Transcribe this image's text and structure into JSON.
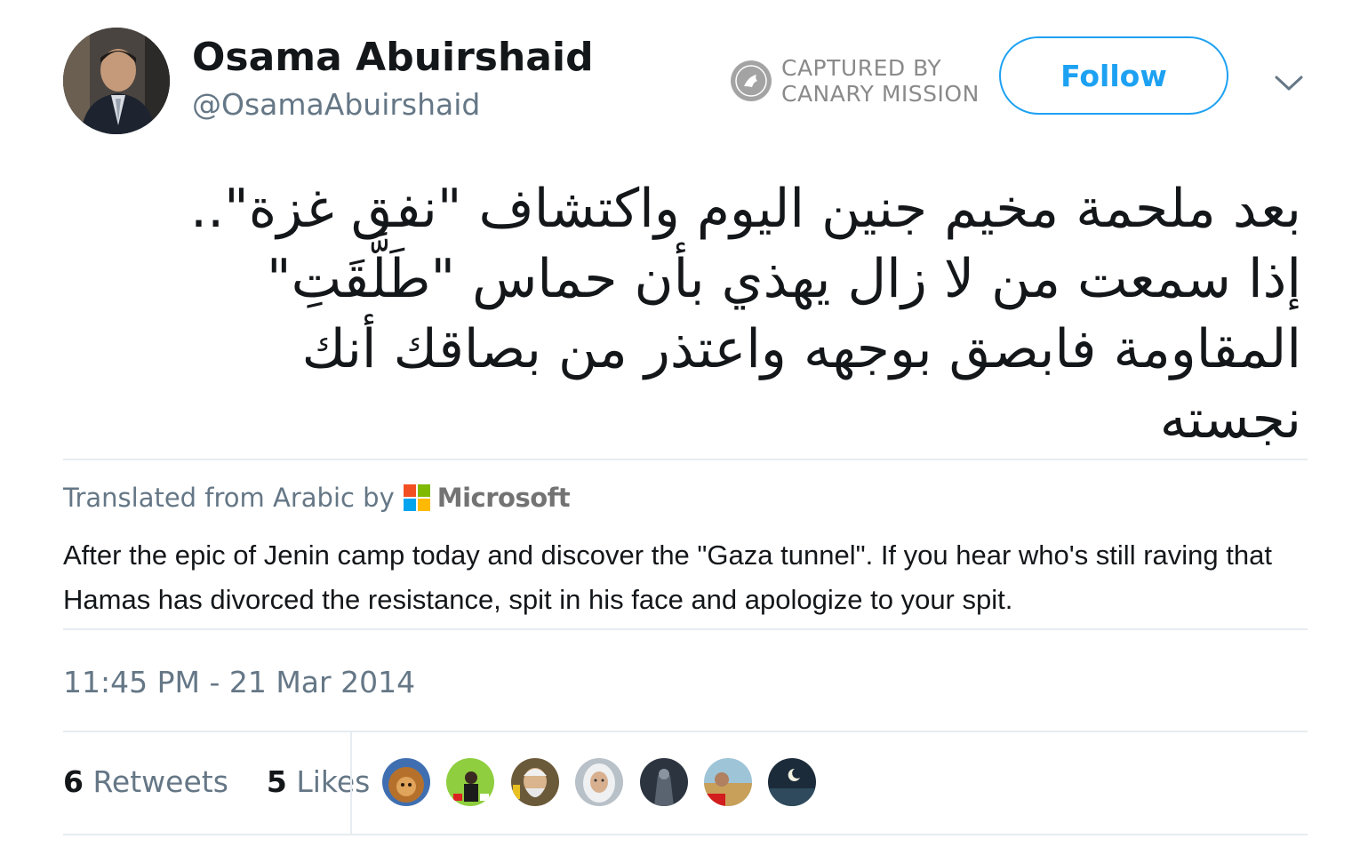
{
  "user": {
    "display_name": "Osama Abuirshaid",
    "handle": "@OsamaAbuirshaid"
  },
  "watermark": {
    "line1": "CAPTURED BY",
    "line2": "CANARY MISSION",
    "logo_icon": "canary-bird-icon"
  },
  "follow_label": "Follow",
  "menu_icon": "chevron-down-icon",
  "tweet": {
    "lines": [
      "بعد ملحمة مخيم جنين اليوم واكتشاف \"نفق غزة\"..",
      "إذا سمعت من لا زال يهذي بأن حماس \"طَلَّقَتِ\"",
      "المقاومة فابصق بوجهه واعتذر من بصاقك أنك",
      "نجسته"
    ],
    "translated_from": "Translated from Arabic by",
    "translator": "Microsoft",
    "translation": "After the epic of Jenin camp today and discover the \"Gaza tunnel\". If you hear who's still raving that Hamas has divorced the resistance, spit in his face and apologize to your spit.",
    "timestamp": "11:45 PM - 21 Mar 2014"
  },
  "stats": {
    "retweets_count": "6",
    "retweets_label": "Retweets",
    "likes_count": "5",
    "likes_label": "Likes"
  },
  "likers": [
    "lion-avatar",
    "green-protest-avatar",
    "older-man-avatar",
    "woman-hijab-avatar",
    "dark-figure-avatar",
    "man-banner-avatar",
    "night-sky-avatar"
  ],
  "colors": {
    "accent": "#1da1f2",
    "secondary_text": "#657786",
    "primary_text": "#14171a",
    "divider": "#e6ecf0"
  }
}
